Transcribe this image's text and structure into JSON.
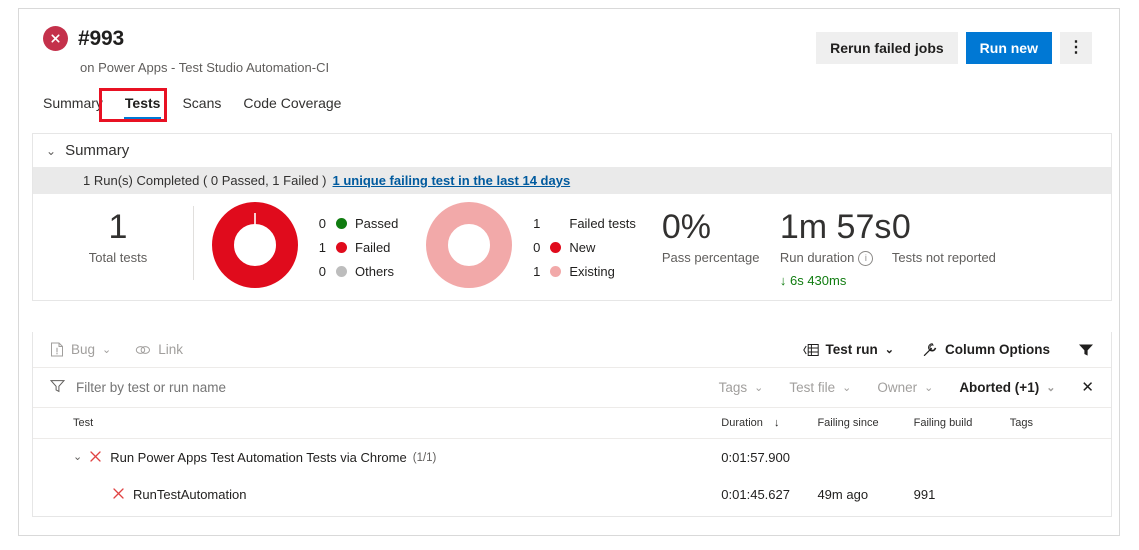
{
  "header": {
    "status_icon": "error-circle-icon",
    "build_number": "#993",
    "subtitle": "on Power Apps - Test Studio Automation-CI",
    "actions": {
      "rerun_label": "Rerun failed jobs",
      "run_new_label": "Run new",
      "more_label": "⋮"
    }
  },
  "tabs": [
    {
      "label": "Summary",
      "active": false
    },
    {
      "label": "Tests",
      "active": true
    },
    {
      "label": "Scans",
      "active": false
    },
    {
      "label": "Code Coverage",
      "active": false
    }
  ],
  "summary": {
    "section_title": "Summary",
    "chevron": "⌄",
    "runs_text": "1 Run(s) Completed ( 0 Passed, 1 Failed )",
    "runs_link": "1 unique failing test in the last 14 days",
    "total_tests": {
      "value": "1",
      "label": "Total tests"
    },
    "outcome_donut": {
      "legend": [
        {
          "count": "0",
          "label": "Passed",
          "color": "#107c10"
        },
        {
          "count": "1",
          "label": "Failed",
          "color": "#e00b1c"
        },
        {
          "count": "0",
          "label": "Others",
          "color": "#bdbdbd"
        }
      ]
    },
    "failure_donut": {
      "legend": [
        {
          "count": "1",
          "label": "Failed tests",
          "color": ""
        },
        {
          "count": "0",
          "label": "New",
          "color": "#e00b1c"
        },
        {
          "count": "1",
          "label": "Existing",
          "color": "#f2a9a9"
        }
      ]
    },
    "pass_percentage": {
      "value": "0%",
      "label": "Pass percentage"
    },
    "run_duration": {
      "value": "1m 57s",
      "label": "Run duration",
      "delta": "6s 430ms",
      "delta_arrow": "↓",
      "info_icon": "info-icon"
    },
    "tests_not_reported": {
      "value": "0",
      "label": "Tests not reported"
    }
  },
  "results": {
    "toolbar": {
      "bug_label": "Bug",
      "bug_icon": "bug-work-item-icon",
      "link_label": "Link",
      "link_icon": "link-icon",
      "test_run_label": "Test run",
      "test_run_icon": "group-list-icon",
      "column_options_label": "Column Options",
      "column_options_icon": "wrench-icon",
      "filter_icon": "filter-solid-icon",
      "chevron": "⌄"
    },
    "filter": {
      "placeholder": "Filter by test or run name",
      "value": "",
      "filter_icon": "funnel-icon",
      "pills": [
        {
          "label": "Tags",
          "selected": false
        },
        {
          "label": "Test file",
          "selected": false
        },
        {
          "label": "Owner",
          "selected": false
        },
        {
          "label": "Aborted (+1)",
          "selected": true
        }
      ],
      "clear_icon": "✕"
    },
    "table": {
      "columns": [
        {
          "label": "Test",
          "sorted": false
        },
        {
          "label": "Duration",
          "sorted": true,
          "sort_arrow": "↓"
        },
        {
          "label": "Failing since",
          "sorted": false
        },
        {
          "label": "Failing build",
          "sorted": false
        },
        {
          "label": "Tags",
          "sorted": false
        }
      ],
      "rows": [
        {
          "type": "group",
          "expand_chevron": "⌄",
          "status_icon": "x-failed-icon",
          "name": "Run Power Apps Test Automation Tests via Chrome",
          "count": "(1/1)",
          "duration": "0:01:57.900",
          "failing_since": "",
          "failing_build": "",
          "tags": ""
        },
        {
          "type": "child",
          "status_icon": "x-failed-icon",
          "name": "RunTestAutomation",
          "count": "",
          "duration": "0:01:45.627",
          "failing_since": "49m ago",
          "failing_build": "991",
          "tags": ""
        }
      ]
    }
  },
  "colors": {
    "accent": "#0078d4",
    "failed_red": "#e00b1c",
    "existing_pink": "#f2a9a9",
    "passed_green": "#107c10",
    "highlight_box": "#e81123"
  }
}
